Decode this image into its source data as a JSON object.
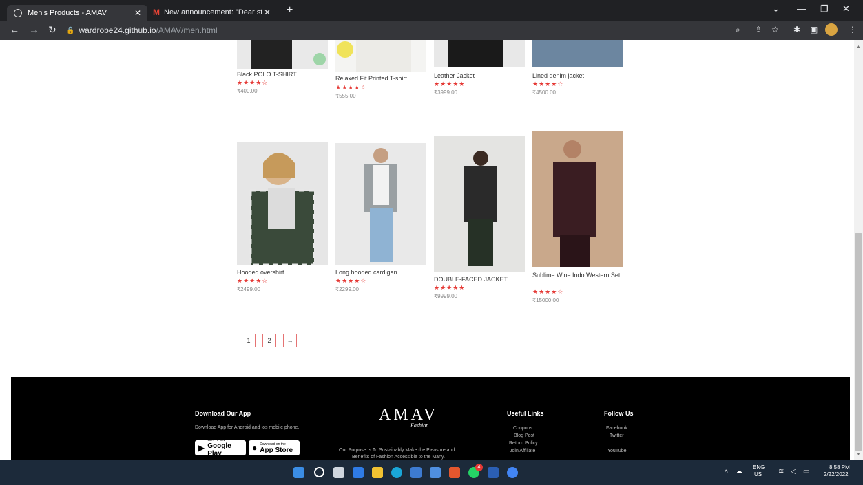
{
  "browser": {
    "tabs": [
      {
        "label": "Men's Products - AMAV",
        "close": "✕"
      },
      {
        "label": "New announcement: \"Dear stude",
        "close": "✕"
      }
    ],
    "new_tab": "+",
    "url_host": "wardrobe24.github.io",
    "url_path": "/AMAV/men.html"
  },
  "products": [
    {
      "name": "Black POLO T-SHIRT",
      "stars": "★★★★☆",
      "price": "₹400.00"
    },
    {
      "name": "Relaxed Fit Printed T-shirt",
      "stars": "★★★★☆",
      "price": "₹555.00"
    },
    {
      "name": "Leather Jacket",
      "stars": "★★★★★",
      "price": "₹3999.00"
    },
    {
      "name": "Lined denim jacket",
      "stars": "★★★★☆",
      "price": "₹4500.00"
    },
    {
      "name": "Hooded overshirt",
      "stars": "★★★★☆",
      "price": "₹2499.00"
    },
    {
      "name": "Long hooded cardigan",
      "stars": "★★★★☆",
      "price": "₹2299.00"
    },
    {
      "name": "DOUBLE-FACED JACKET",
      "stars": "★★★★★",
      "price": "₹9999.00"
    },
    {
      "name": "Sublime Wine Indo Western Set",
      "stars": "★★★★☆",
      "price": "₹15000.00"
    }
  ],
  "pagination": [
    "1",
    "2",
    "→"
  ],
  "footer": {
    "download_title": "Download Our App",
    "download_text": "Download App for Android and ios mobile phone.",
    "google_small": "GET IT ON",
    "google_big": "Google Play",
    "apple_small": "Download on the",
    "apple_big": "App Store",
    "logo": "AMAV",
    "logo_sub": "Fashion",
    "purpose_line1": "Our Purpose Is To Sustainably Make the Pleasure and",
    "purpose_line2": "Benefits of Fashion Accessible to the Many.",
    "useful_title": "Useful Links",
    "useful_links": [
      "Coupons",
      "Blog Post",
      "Return Policy",
      "Join Affiliate"
    ],
    "follow_title": "Follow Us",
    "follow_links": [
      "Facebook",
      "Twitter",
      "YouTube"
    ]
  },
  "taskbar": {
    "lang1": "ENG",
    "lang2": "US",
    "time": "8:58 PM",
    "date": "2/22/2022",
    "whatsapp_badge": "4"
  }
}
